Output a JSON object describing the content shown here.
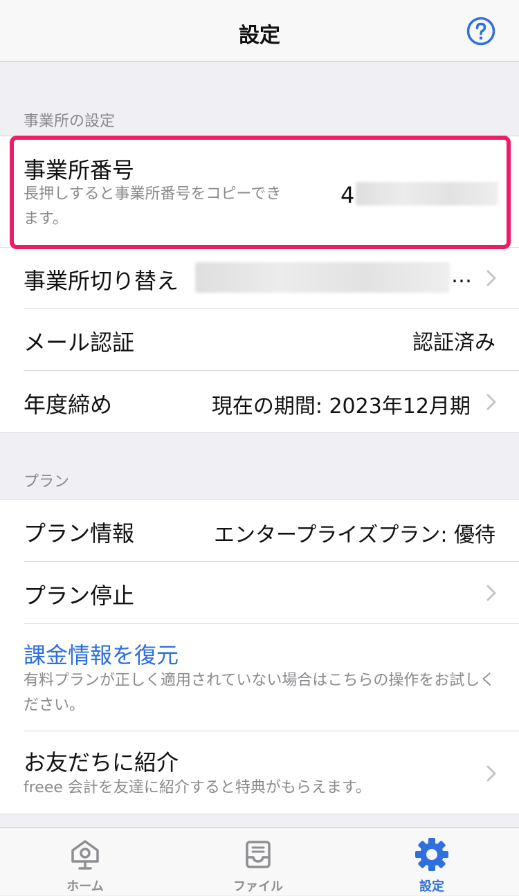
{
  "nav": {
    "title": "設定",
    "help_icon": "question-circle-icon"
  },
  "office_section": {
    "header": "事業所の設定",
    "office_number": {
      "label": "事業所番号",
      "description": "長押しすると事業所番号をコピーできます。",
      "value_visible_prefix": "4"
    },
    "office_switch": {
      "label": "事業所切り替え",
      "value_suffix": "…"
    },
    "email_verify": {
      "label": "メール認証",
      "value": "認証済み"
    },
    "fiscal_close": {
      "label": "年度締め",
      "value": "現在の期間: 2023年12月期"
    }
  },
  "plan_section": {
    "header": "プラン",
    "plan_info": {
      "label": "プラン情報",
      "value": "エンタープライズプラン: 優待"
    },
    "plan_stop": {
      "label": "プラン停止"
    },
    "restore": {
      "label": "課金情報を復元",
      "description": "有料プランが正しく適用されていない場合はこちらの操作をお試しください。"
    },
    "refer": {
      "label": "お友だちに紹介",
      "description": "freee 会計を友達に紹介すると特典がもらえます。"
    }
  },
  "tabbar": {
    "home": "ホーム",
    "file": "ファイル",
    "settings": "設定"
  },
  "colors": {
    "accent": "#2f6fde",
    "highlight": "#ee1c67",
    "inactive_tab": "#8e8e93"
  }
}
